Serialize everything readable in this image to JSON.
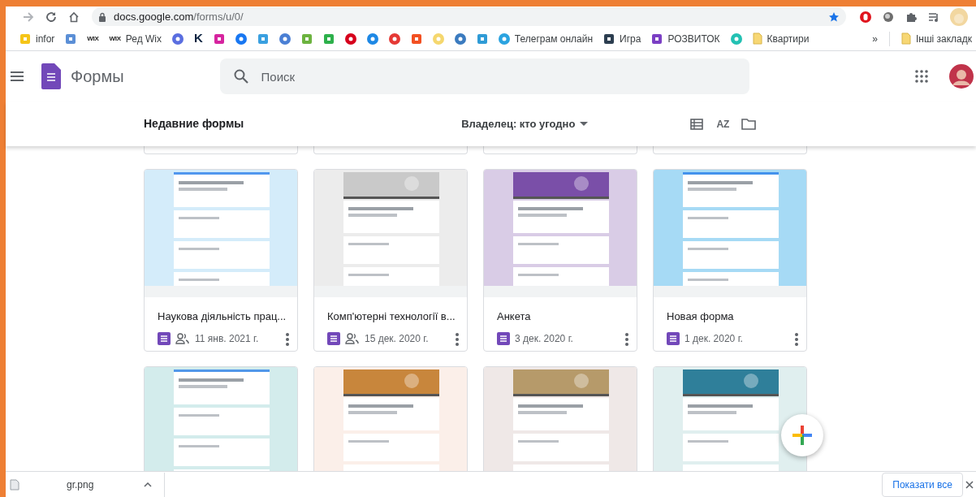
{
  "browser": {
    "url_host": "docs.google.com",
    "url_path": "/forms/u/0/"
  },
  "bookmarks": [
    {
      "kind": "square",
      "color": "#f5c518",
      "label": "infor"
    },
    {
      "kind": "square",
      "color": "#5b8fd6"
    },
    {
      "kind": "logo",
      "color": "#222222",
      "icon_text": "WIX"
    },
    {
      "kind": "logo",
      "color": "#222222",
      "icon_text": "WIX",
      "label": "Ред Wix"
    },
    {
      "kind": "circle",
      "color": "#5a6ee0"
    },
    {
      "kind": "logo",
      "color": "#0c2340",
      "icon_text": "K"
    },
    {
      "kind": "square",
      "color": "#d6249f"
    },
    {
      "kind": "circle",
      "color": "#1877f2"
    },
    {
      "kind": "square",
      "color": "#3aa0e0"
    },
    {
      "kind": "circle",
      "color": "#4a7fd4"
    },
    {
      "kind": "square",
      "color": "#6cb33f"
    },
    {
      "kind": "square",
      "color": "#2db04b"
    },
    {
      "kind": "circle",
      "color": "#d6001c"
    },
    {
      "kind": "circle",
      "color": "#1e88e5"
    },
    {
      "kind": "circle",
      "color": "#e53935"
    },
    {
      "kind": "square",
      "color": "#f25022"
    },
    {
      "kind": "circle",
      "color": "#f5d76e"
    },
    {
      "kind": "circle",
      "color": "#3b7bbf"
    },
    {
      "kind": "square",
      "color": "#2f9bd6"
    },
    {
      "kind": "circle",
      "color": "#2aa3e0",
      "label": "Телеграм онлайн"
    },
    {
      "kind": "square",
      "color": "#2c3e50",
      "label": "Игра"
    },
    {
      "kind": "square",
      "color": "#7b3fc4",
      "label": "РОЗВИТОК"
    },
    {
      "kind": "circle",
      "color": "#23c1b3"
    },
    {
      "kind": "folder",
      "color": "#f7d774",
      "label": "Квартири"
    }
  ],
  "bookmarks_more": "»",
  "other_bookmarks": "Інші закладк",
  "app": {
    "title": "Формы",
    "search_placeholder": "Поиск"
  },
  "toolbar": {
    "heading": "Недавние формы",
    "owner_filter": "Владелец: кто угодно",
    "sort_label": "AZ"
  },
  "forms": [
    {
      "title": "Наукова діяльність прац...",
      "date": "11 янв. 2021 г.",
      "shared": true
    },
    {
      "title": "Комп'ютерні технології в...",
      "date": "15 дек. 2020 г.",
      "shared": true
    },
    {
      "title": "Анкета",
      "date": "3 дек. 2020 г.",
      "shared": false
    },
    {
      "title": "Новая форма",
      "date": "1 дек. 2020 г.",
      "shared": false
    }
  ],
  "download": {
    "file": "gr.png",
    "show_all": "Показати все"
  }
}
